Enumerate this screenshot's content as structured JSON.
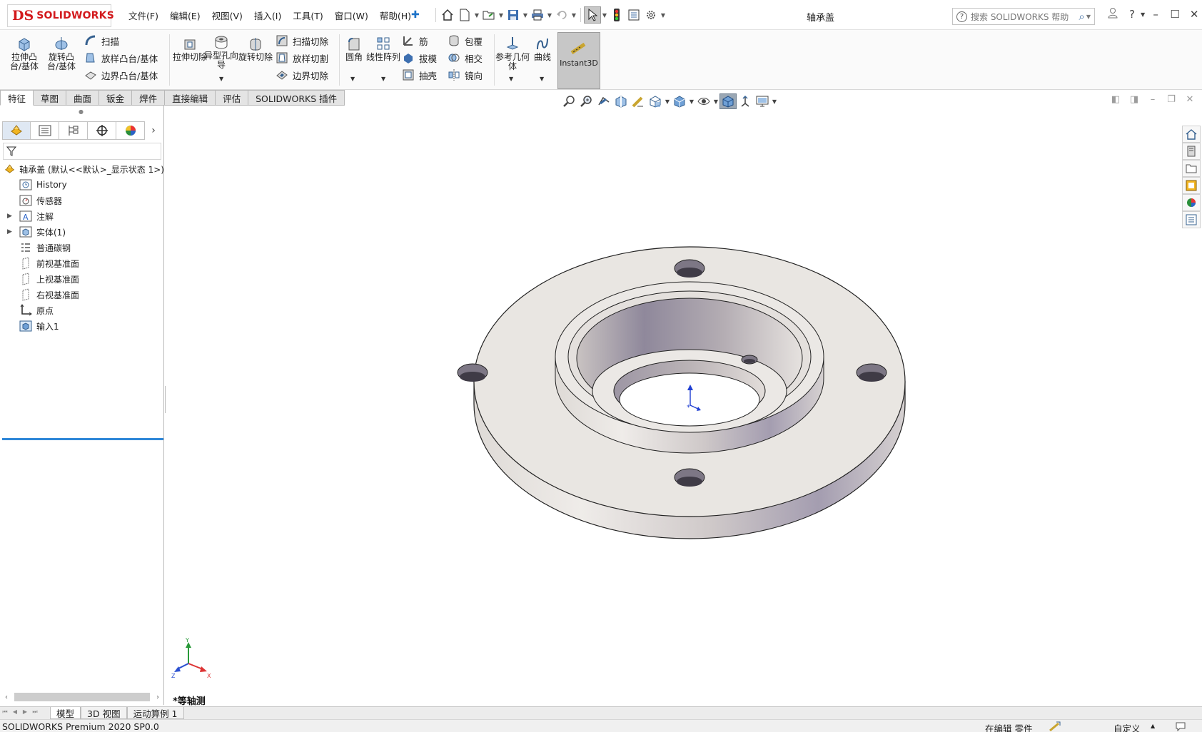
{
  "app": {
    "logo_mark": "DS",
    "logo_text": "SOLIDWORKS",
    "document_title": "轴承盖"
  },
  "menu": [
    "文件(F)",
    "编辑(E)",
    "视图(V)",
    "插入(I)",
    "工具(T)",
    "窗口(W)",
    "帮助(H)"
  ],
  "quick_access": [
    {
      "name": "home-icon"
    },
    {
      "name": "new-document-icon"
    },
    {
      "name": "open-icon"
    },
    {
      "name": "save-icon"
    },
    {
      "name": "print-icon"
    },
    {
      "name": "undo-icon"
    },
    {
      "name": "select-icon"
    },
    {
      "name": "rebuild-icon"
    },
    {
      "name": "file-properties-icon"
    },
    {
      "name": "options-icon"
    }
  ],
  "help_search": {
    "placeholder": "搜索 SOLIDWORKS 帮助"
  },
  "command_manager": {
    "extrude_boss": "拉伸凸台/基体",
    "revolve_boss": "旋转凸台/基体",
    "sweep": "扫描",
    "loft_boss": "放样凸台/基体",
    "boundary_boss": "边界凸台/基体",
    "extrude_cut": "拉伸切除",
    "hole_wizard": "异型孔向导",
    "revolve_cut": "旋转切除",
    "sweep_cut": "扫描切除",
    "loft_cut": "放样切割",
    "boundary_cut": "边界切除",
    "fillet": "圆角",
    "linear_pattern": "线性阵列",
    "rib": "筋",
    "draft": "拔模",
    "shell": "抽壳",
    "wrap": "包覆",
    "intersect": "相交",
    "mirror": "镜向",
    "reference_geometry": "参考几何体",
    "curves": "曲线",
    "instant3d": "Instant3D"
  },
  "command_tabs": [
    "特征",
    "草图",
    "曲面",
    "钣金",
    "焊件",
    "直接编辑",
    "评估",
    "SOLIDWORKS 插件"
  ],
  "feature_tree": {
    "root": "轴承盖  (默认<<默认>_显示状态 1>)",
    "items": [
      {
        "label": "History",
        "icon": "history-icon",
        "expandable": false
      },
      {
        "label": "传感器",
        "icon": "sensor-icon",
        "expandable": false
      },
      {
        "label": "注解",
        "icon": "annotations-icon",
        "expandable": true
      },
      {
        "label": "实体(1)",
        "icon": "solid-bodies-icon",
        "expandable": true
      },
      {
        "label": "普通碳钢",
        "icon": "material-icon",
        "expandable": false
      },
      {
        "label": "前视基准面",
        "icon": "plane-icon",
        "expandable": false
      },
      {
        "label": "上视基准面",
        "icon": "plane-icon",
        "expandable": false
      },
      {
        "label": "右视基准面",
        "icon": "plane-icon",
        "expandable": false
      },
      {
        "label": "原点",
        "icon": "origin-icon",
        "expandable": false
      },
      {
        "label": "输入1",
        "icon": "imported-body-icon",
        "expandable": false
      }
    ]
  },
  "graphics": {
    "view_name": "*等轴测",
    "triad": {
      "x": "X",
      "y": "Y",
      "z": "Z"
    }
  },
  "model_tabs": [
    "模型",
    "3D 视图",
    "运动算例 1"
  ],
  "status": {
    "version": "SOLIDWORKS Premium 2020 SP0.0",
    "mode": "在编辑 零件",
    "units": "自定义",
    "caret": "▲"
  },
  "colors": {
    "brand_red": "#d3191c",
    "part_face": "#e9e6e2",
    "part_side": "#a39cad",
    "selection_blue": "#2f87d8"
  }
}
